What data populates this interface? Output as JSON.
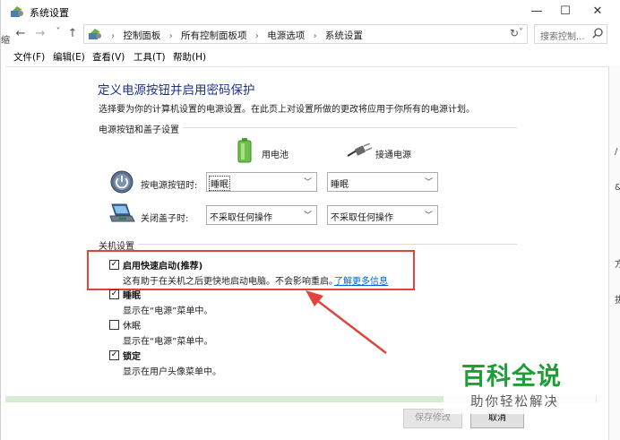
{
  "window": {
    "title": "系统设置",
    "minimize": "—",
    "maximize": "☐",
    "close": "✕"
  },
  "address_bar": {
    "back": "←",
    "forward": "→",
    "recent": "˅",
    "up": "↑",
    "crumbs": [
      "控制面板",
      "所有控制面板项",
      "电源选项",
      "系统设置"
    ],
    "separator": "›",
    "dropdown": "˅",
    "refresh": "↻",
    "search_placeholder": "搜索控制..."
  },
  "menubar": {
    "items": [
      "文件(F)",
      "编辑(E)",
      "查看(V)",
      "工具(T)",
      "帮助(H)"
    ]
  },
  "page": {
    "heading": "定义电源按钮并启用密码保护",
    "subtext": "选择要为你的计算机设置的电源设置。在此页上对设置所做的更改将应用于你所有的电源计划。",
    "section_power_buttons": "电源按钮和盖子设置",
    "col_battery": "用电池",
    "col_plugged": "接通电源",
    "row_power_button": "按电源按钮时:",
    "row_lid": "关闭盖子时:",
    "power_button_battery": "睡眠",
    "power_button_plugged": "睡眠",
    "lid_battery": "不采取任何操作",
    "lid_plugged": "不采取任何操作",
    "section_shutdown": "关机设置",
    "options": [
      {
        "title": "启用快速启动(推荐)",
        "desc": "这有助于在关机之后更快地启动电脑。不会影响重启。",
        "link": "了解更多信息",
        "checked": true
      },
      {
        "title": "睡眠",
        "desc": "显示在“电源”菜单中。",
        "checked": true
      },
      {
        "title": "休眠",
        "desc": "显示在“电源”菜单中。",
        "checked": false
      },
      {
        "title": "锁定",
        "desc": "显示在用户头像菜单中。",
        "checked": true
      }
    ],
    "save_button": "保存修改",
    "cancel_button": "取消"
  },
  "watermark": {
    "title": "百科全说",
    "subtitle": "助你轻松解决"
  },
  "edge": {
    "left": "缩",
    "right": [
      "/",
      "&",
      "方",
      "拔"
    ]
  },
  "colors": {
    "heading": "#1e3287",
    "highlight": "#e0443a",
    "watermark_green": "#1e9e36",
    "link": "#0066cc"
  },
  "icons": {
    "app": "control-panel-icon",
    "power": "power-button-icon",
    "lid": "laptop-lid-icon",
    "battery": "battery-icon",
    "plug": "plug-icon",
    "search": "search-icon"
  }
}
